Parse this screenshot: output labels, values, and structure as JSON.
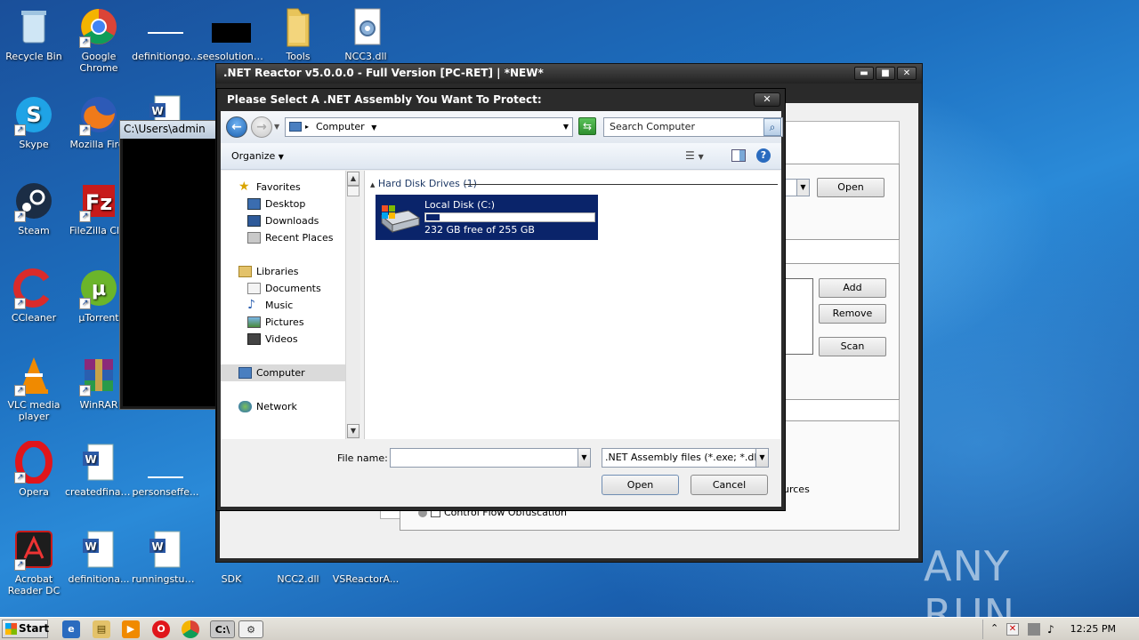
{
  "desktop": {
    "icons": [
      {
        "label": "Recycle Bin"
      },
      {
        "label": "Google Chrome"
      },
      {
        "label": "definitiongo..."
      },
      {
        "label": "seesolution...."
      },
      {
        "label": "Tools"
      },
      {
        "label": "NCC3.dll"
      },
      {
        "label": "Skype"
      },
      {
        "label": "Mozilla Firef"
      },
      {
        "label": "Steam"
      },
      {
        "label": "FileZilla Clie"
      },
      {
        "label": "CCleaner"
      },
      {
        "label": "µTorrent"
      },
      {
        "label": "VLC media player"
      },
      {
        "label": "WinRAR"
      },
      {
        "label": "Opera"
      },
      {
        "label": "createdfinal..."
      },
      {
        "label": "personseffe..."
      },
      {
        "label": "Acrobat Reader DC"
      },
      {
        "label": "definitiona..."
      },
      {
        "label": "runningstud..."
      },
      {
        "label": "SDK"
      },
      {
        "label": "NCC2.dll"
      },
      {
        "label": "VSReactorA..."
      }
    ]
  },
  "console": {
    "title": "C:\\Users\\admin"
  },
  "reactor": {
    "title": ".NET Reactor v5.0.0.0 - Full Version [PC-RET]  | *NEW*",
    "buttons": {
      "open": "Open",
      "add": "Add",
      "remove": "Remove",
      "scan": "Scan"
    },
    "partial_text": {
      "sources": "urces",
      "control_flow": "Control Flow Obfuscation"
    }
  },
  "dialog": {
    "title": "Please Select A .NET Assembly You Want To Protect:",
    "address": "Computer",
    "search_placeholder": "Search Computer",
    "organize": "Organize",
    "nav": {
      "favorites": "Favorites",
      "desktop": "Desktop",
      "downloads": "Downloads",
      "recent": "Recent Places",
      "libraries": "Libraries",
      "documents": "Documents",
      "music": "Music",
      "pictures": "Pictures",
      "videos": "Videos",
      "computer": "Computer",
      "network": "Network"
    },
    "group_header": "Hard Disk Drives (1)",
    "drive": {
      "name": "Local Disk (C:)",
      "space": "232 GB free of 255 GB",
      "used_fraction": 0.09
    },
    "file_name_label": "File name:",
    "file_name_value": "",
    "file_type": ".NET Assembly files (*.exe; *.dll;",
    "open_button": "Open",
    "cancel_button": "Cancel"
  },
  "taskbar": {
    "start": "Start",
    "clock": "12:25 PM"
  },
  "watermark": "ANY RUN"
}
